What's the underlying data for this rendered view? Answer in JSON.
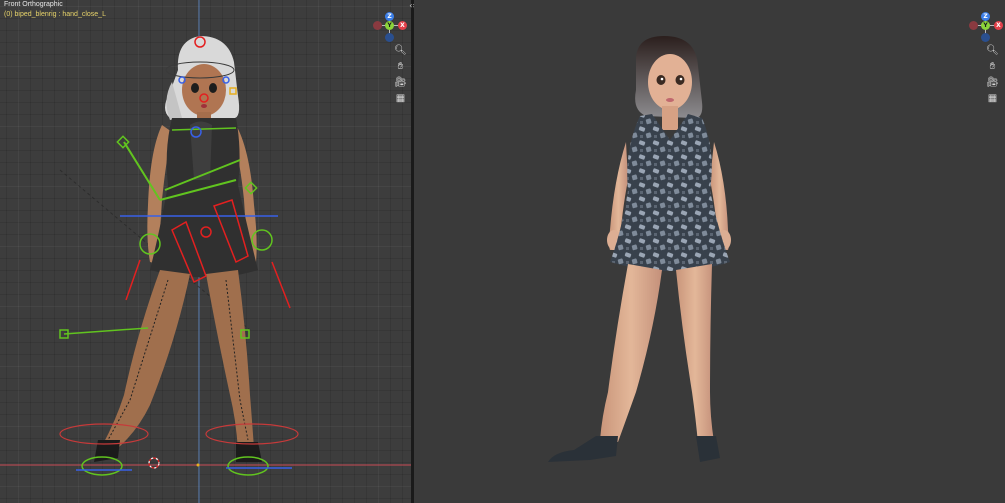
{
  "left_viewport": {
    "view_name": "Front Orthographic",
    "object_name": "(0) biped_blenrig : hand_close_L",
    "gizmo_axes": {
      "z": "Z",
      "y": "Y",
      "x": "X"
    }
  },
  "right_viewport": {
    "gizmo_axes": {
      "z": "Z",
      "y": "Y",
      "x": "X"
    }
  },
  "tool_icons": [
    "zoom-icon",
    "hand-pan-icon",
    "camera-icon",
    "grid-icon"
  ],
  "colors": {
    "axis_x": "#e2404a",
    "axis_y": "#8bd43a",
    "axis_z": "#3c7fe8",
    "object_text": "#e7d36a",
    "bone_red": "#e32020",
    "bone_green": "#61c41f",
    "bone_blue": "#3860e8"
  }
}
